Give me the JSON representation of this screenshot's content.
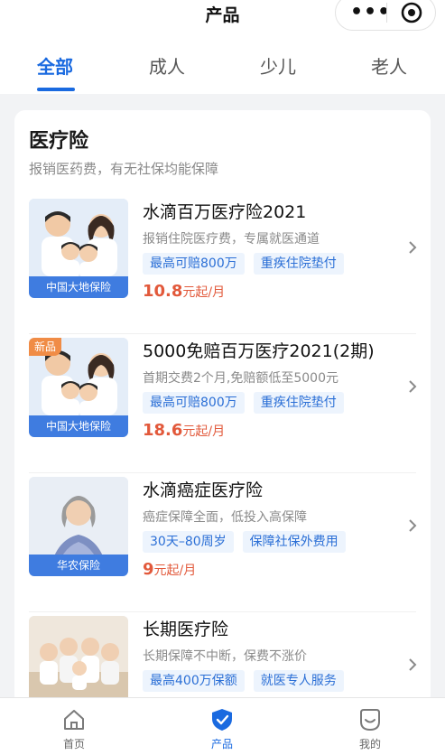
{
  "app": {
    "title": "产品"
  },
  "tabs": [
    {
      "label": "全部",
      "active": true
    },
    {
      "label": "成人",
      "active": false
    },
    {
      "label": "少儿",
      "active": false
    },
    {
      "label": "老人",
      "active": false
    }
  ],
  "section": {
    "title": "医疗险",
    "subtitle": "报销医药费，有无社保均能保障"
  },
  "products": [
    {
      "name": "水滴百万医疗险2021",
      "desc": "报销住院医疗费，专属就医通道",
      "tags": [
        "最高可赔800万",
        "重疾住院垫付"
      ],
      "price": "10.8",
      "unit": "元起/月",
      "insurer": "中国大地保险",
      "badge": ""
    },
    {
      "name": "5000免赔百万医疗2021(2期)",
      "desc": "首期交费2个月,免赔额低至5000元",
      "tags": [
        "最高可赔800万",
        "重疾住院垫付"
      ],
      "price": "18.6",
      "unit": "元起/月",
      "insurer": "中国大地保险",
      "badge": "新品"
    },
    {
      "name": "水滴癌症医疗险",
      "desc": "癌症保障全面，低投入高保障",
      "tags": [
        "30天–80周岁",
        "保障社保外费用"
      ],
      "price": "9",
      "unit": "元起/月",
      "insurer": "华农保险",
      "badge": ""
    },
    {
      "name": "长期医疗险",
      "desc": "长期保障不中断，保费不涨价",
      "tags": [
        "最高400万保额",
        "就医专人服务"
      ],
      "price": "",
      "unit": "",
      "insurer": "",
      "badge": ""
    }
  ],
  "bottom_nav": [
    {
      "label": "首页",
      "icon": "home-icon",
      "active": false
    },
    {
      "label": "产品",
      "icon": "shield-icon",
      "active": true
    },
    {
      "label": "我的",
      "icon": "smile-icon",
      "active": false
    }
  ],
  "colors": {
    "accent": "#1a6ae0",
    "price": "#e2593b",
    "tag_bg": "#edf4fd",
    "badge": "#f08c46"
  }
}
